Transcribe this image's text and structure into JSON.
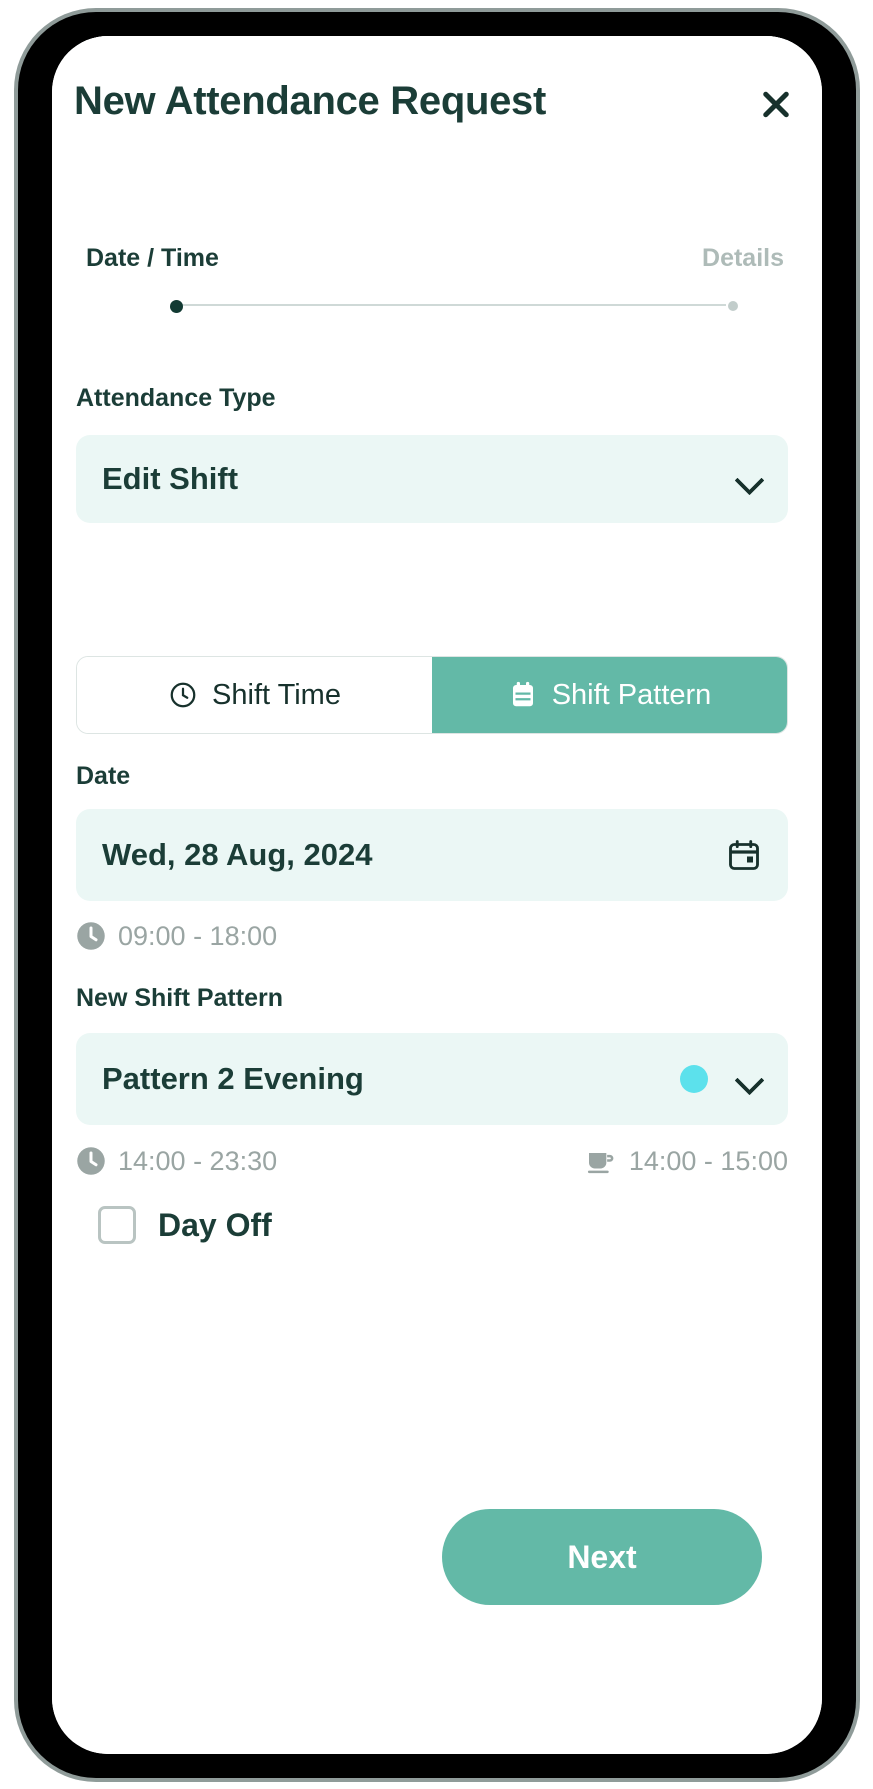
{
  "header": {
    "title": "New Attendance Request",
    "close_icon": "close-icon"
  },
  "stepper": {
    "steps": [
      {
        "label": "Date / Time",
        "state": "active"
      },
      {
        "label": "Details",
        "state": "upcoming"
      }
    ]
  },
  "attendance_type": {
    "label": "Attendance Type",
    "value": "Edit Shift",
    "chevron_icon": "chevron-down-icon"
  },
  "mode_tabs": [
    {
      "label": "Shift Time",
      "icon": "clock-icon",
      "active": false
    },
    {
      "label": "Shift Pattern",
      "icon": "calendar-icon",
      "active": true
    }
  ],
  "date_section": {
    "label": "Date",
    "value": "Wed, 28 Aug, 2024",
    "calendar_icon": "calendar-icon",
    "time_icon": "clock-icon",
    "time_range": "09:00 - 18:00"
  },
  "pattern_section": {
    "label": "New Shift Pattern",
    "value": "Pattern 2 Evening",
    "dot_color": "#5ce1ec",
    "chevron_icon": "chevron-down-icon",
    "time_icon": "clock-icon",
    "time_range": "14:00 - 23:30",
    "break_icon": "coffee-cup-icon",
    "break_range": "14:00 - 15:00"
  },
  "day_off": {
    "label": "Day Off",
    "checked": false
  },
  "footer": {
    "next_label": "Next"
  },
  "colors": {
    "accent": "#63b9a7",
    "dark_teal": "#1b3d37",
    "field_bg": "#ebf7f5",
    "muted": "#9aa5a3",
    "pattern_dot": "#5ce1ec"
  }
}
